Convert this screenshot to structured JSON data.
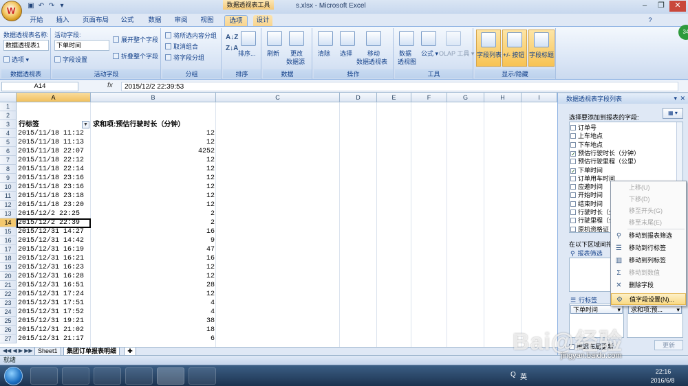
{
  "window": {
    "title": "s.xlsx - Microsoft Excel",
    "context_tab_title": "数据透视表工具",
    "office_logo": "W"
  },
  "tabs": [
    "开始",
    "插入",
    "页面布局",
    "公式",
    "数据",
    "审阅",
    "视图",
    "选项",
    "设计"
  ],
  "active_tab": "选项",
  "ribbon": {
    "pt_name_label": "数据透视表名称:",
    "pt_name_value": "数据透视表1",
    "pt_options": "选项",
    "grp_pivottable": "数据透视表",
    "active_field_label": "活动字段:",
    "active_field_value": "下单时间",
    "field_settings": "字段设置",
    "expand_field": "展开整个字段",
    "collapse_field": "折叠整个字段",
    "grp_active_field": "活动字段",
    "group_selection": "将所选内容分组",
    "ungroup": "取消组合",
    "group_field": "将字段分组",
    "grp_group": "分组",
    "sort": "排序...",
    "grp_sort": "排序",
    "refresh": "刷新",
    "change_source": "更改",
    "change_source_2": "数据源",
    "grp_data": "数据",
    "clear": "清除",
    "select": "选择",
    "move": "移动",
    "move_2": "数据透视表",
    "grp_actions": "操作",
    "pivotchart": "数据",
    "pivotchart_2": "透视图",
    "formulas": "公式",
    "olap": "OLAP 工具",
    "grp_tools": "工具",
    "field_list": "字段列表",
    "buttons": "+/- 按钮",
    "field_headers": "字段标题",
    "grp_show": "显示/隐藏"
  },
  "formula_bar": {
    "name_box": "A14",
    "fx": "fx",
    "content": "2015/12/2  22:39:53"
  },
  "columns": [
    "A",
    "B",
    "C",
    "D",
    "E",
    "F",
    "G",
    "H",
    "I"
  ],
  "header_row": {
    "a": "行标签",
    "b": "求和项:预估行驶时长（分钟）"
  },
  "rows": [
    {
      "n": "4",
      "a": "2015/11/18 11:12",
      "b": "12"
    },
    {
      "n": "5",
      "a": "2015/11/18 11:13",
      "b": "12"
    },
    {
      "n": "6",
      "a": "2015/11/18 22:07",
      "b": "4252"
    },
    {
      "n": "7",
      "a": "2015/11/18 22:12",
      "b": "12"
    },
    {
      "n": "8",
      "a": "2015/11/18 22:14",
      "b": "12"
    },
    {
      "n": "9",
      "a": "2015/11/18 23:16",
      "b": "12"
    },
    {
      "n": "10",
      "a": "2015/11/18 23:16",
      "b": "12"
    },
    {
      "n": "11",
      "a": "2015/11/18 23:18",
      "b": "12"
    },
    {
      "n": "12",
      "a": "2015/11/18 23:20",
      "b": "12"
    },
    {
      "n": "13",
      "a": "2015/12/2 22:25",
      "b": "2"
    },
    {
      "n": "14",
      "a": "2015/12/2 22:39",
      "b": "2"
    },
    {
      "n": "15",
      "a": "2015/12/31 14:27",
      "b": "16"
    },
    {
      "n": "16",
      "a": "2015/12/31 14:42",
      "b": "9"
    },
    {
      "n": "17",
      "a": "2015/12/31 16:19",
      "b": "47"
    },
    {
      "n": "18",
      "a": "2015/12/31 16:21",
      "b": "16"
    },
    {
      "n": "19",
      "a": "2015/12/31 16:23",
      "b": "12"
    },
    {
      "n": "20",
      "a": "2015/12/31 16:28",
      "b": "12"
    },
    {
      "n": "21",
      "a": "2015/12/31 16:51",
      "b": "28"
    },
    {
      "n": "22",
      "a": "2015/12/31 17:24",
      "b": "12"
    },
    {
      "n": "23",
      "a": "2015/12/31 17:51",
      "b": "4"
    },
    {
      "n": "24",
      "a": "2015/12/31 17:52",
      "b": "4"
    },
    {
      "n": "25",
      "a": "2015/12/31 19:21",
      "b": "38"
    },
    {
      "n": "26",
      "a": "2015/12/31 21:02",
      "b": "18"
    },
    {
      "n": "27",
      "a": "2015/12/31 21:17",
      "b": "6"
    }
  ],
  "sheet_tabs": [
    "Sheet1",
    "集团订单报表明细"
  ],
  "status": "就绪",
  "pane": {
    "title": "数据透视表字段列表",
    "choose_label": "选择要添加到报表的字段:",
    "fields": [
      {
        "label": "订单号",
        "checked": ""
      },
      {
        "label": "上车地点",
        "checked": ""
      },
      {
        "label": "下车地点",
        "checked": ""
      },
      {
        "label": "预估行驶时长（分钟）",
        "checked": "✓"
      },
      {
        "label": "预估行驶里程（公里）",
        "checked": ""
      },
      {
        "label": "下单时间",
        "checked": "✓"
      },
      {
        "label": "订单用车时间",
        "checked": ""
      },
      {
        "label": "应邀时间",
        "checked": ""
      },
      {
        "label": "开始时间",
        "checked": ""
      },
      {
        "label": "结束时间",
        "checked": ""
      },
      {
        "label": "行驶时长（分",
        "checked": ""
      },
      {
        "label": "行驶里程（公",
        "checked": ""
      },
      {
        "label": "原机资格证",
        "checked": ""
      }
    ],
    "drag_label": "在以下区域间拖",
    "report_filter": "报表筛选",
    "row_labels": "行标签",
    "row_chip": "下单时间",
    "values_chip": "求和项:预...",
    "defer": "推迟布局更新",
    "update": "更新"
  },
  "context_menu": [
    {
      "label": "上移(U)",
      "disabled": true,
      "icon": ""
    },
    {
      "label": "下移(D)",
      "disabled": true,
      "icon": ""
    },
    {
      "label": "移至开头(G)",
      "disabled": true,
      "icon": ""
    },
    {
      "label": "移至末尾(E)",
      "disabled": true,
      "icon": ""
    },
    {
      "label": "移动到报表筛选",
      "disabled": false,
      "icon": "funnel-icon"
    },
    {
      "label": "移动到行标签",
      "disabled": false,
      "icon": "rows-icon"
    },
    {
      "label": "移动到列标签",
      "disabled": false,
      "icon": "columns-icon"
    },
    {
      "label": "移动到数值",
      "disabled": true,
      "icon": "sigma-icon"
    },
    {
      "label": "删除字段",
      "disabled": false,
      "icon": "delete-icon"
    },
    {
      "label": "值字段设置(N)...",
      "disabled": false,
      "icon": "settings-icon"
    }
  ],
  "taskbar": {
    "time": "22:16",
    "date": "2016/6/8",
    "ime": "英",
    "tray_q": "Q"
  },
  "watermark": {
    "text": "Bai@经验",
    "url": "jingyan.baidu.com"
  },
  "badge": "34"
}
